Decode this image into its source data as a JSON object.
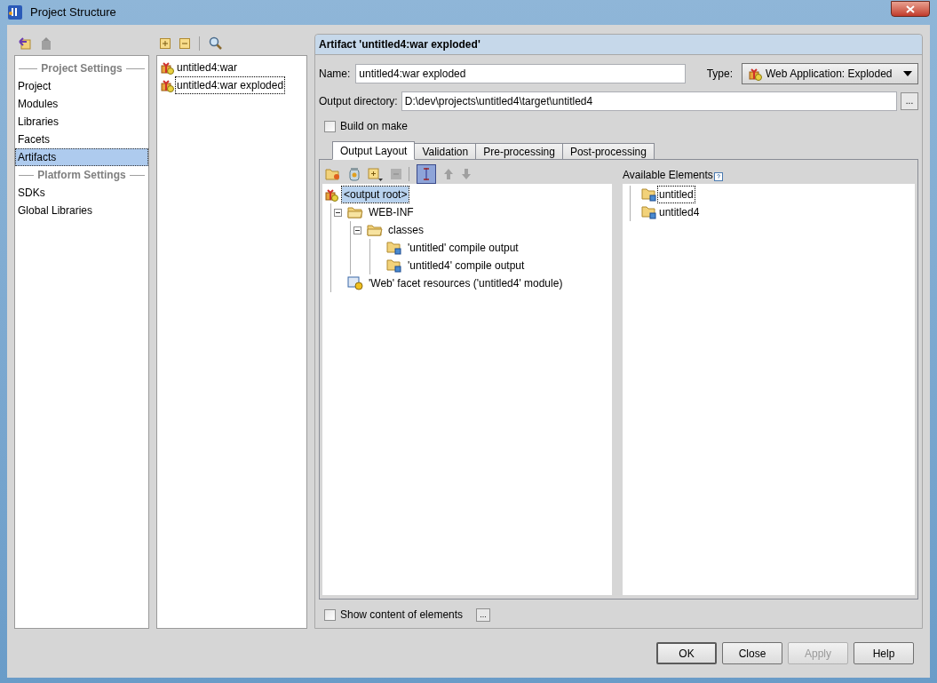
{
  "window": {
    "title": "Project Structure"
  },
  "sidebar": {
    "sections": [
      {
        "heading": "Project Settings",
        "items": [
          {
            "label": "Project",
            "selected": false
          },
          {
            "label": "Modules",
            "selected": false
          },
          {
            "label": "Libraries",
            "selected": false
          },
          {
            "label": "Facets",
            "selected": false
          },
          {
            "label": "Artifacts",
            "selected": true
          }
        ]
      },
      {
        "heading": "Platform Settings",
        "items": [
          {
            "label": "SDKs",
            "selected": false
          },
          {
            "label": "Global Libraries",
            "selected": false
          }
        ]
      }
    ]
  },
  "artifacts": [
    {
      "label": "untitled4:war",
      "selected": false
    },
    {
      "label": "untitled4:war exploded",
      "selected": true
    }
  ],
  "editor": {
    "title": "Artifact 'untitled4:war exploded'",
    "name": {
      "label": "Name:",
      "value": "untitled4:war exploded"
    },
    "type": {
      "label": "Type:",
      "value": "Web Application: Exploded"
    },
    "output_directory": {
      "label": "Output directory:",
      "value": "D:\\dev\\projects\\untitled4\\target\\untitled4",
      "browse": "..."
    },
    "build_on_make": {
      "label": "Build on make",
      "checked": false
    },
    "tabs": [
      {
        "label": "Output Layout",
        "selected": true
      },
      {
        "label": "Validation",
        "selected": false
      },
      {
        "label": "Pre-processing",
        "selected": false
      },
      {
        "label": "Post-processing",
        "selected": false
      }
    ],
    "sort_pressed": true,
    "layout_tree": [
      {
        "label": "<output root>",
        "kind": "artifact",
        "selected": true,
        "children": [
          {
            "label": "WEB-INF",
            "kind": "folder",
            "expanded": true,
            "children": [
              {
                "label": "classes",
                "kind": "folder",
                "expanded": true,
                "children": [
                  {
                    "label": "'untitled' compile output",
                    "kind": "module-output"
                  },
                  {
                    "label": "'untitled4' compile output",
                    "kind": "module-output"
                  }
                ]
              }
            ]
          },
          {
            "label": "'Web' facet resources ('untitled4' module)",
            "kind": "facet"
          }
        ]
      }
    ],
    "available": {
      "label": "Available Elements",
      "items": [
        {
          "label": "untitled",
          "selected": true
        },
        {
          "label": "untitled4",
          "selected": false
        }
      ]
    },
    "show_content": {
      "label": "Show content of elements",
      "checked": false,
      "more": "..."
    }
  },
  "buttons": [
    {
      "label": "OK",
      "disabled": false,
      "default": true
    },
    {
      "label": "Close",
      "disabled": false,
      "default": false
    },
    {
      "label": "Apply",
      "disabled": true,
      "default": false
    },
    {
      "label": "Help",
      "disabled": false,
      "default": false
    }
  ]
}
